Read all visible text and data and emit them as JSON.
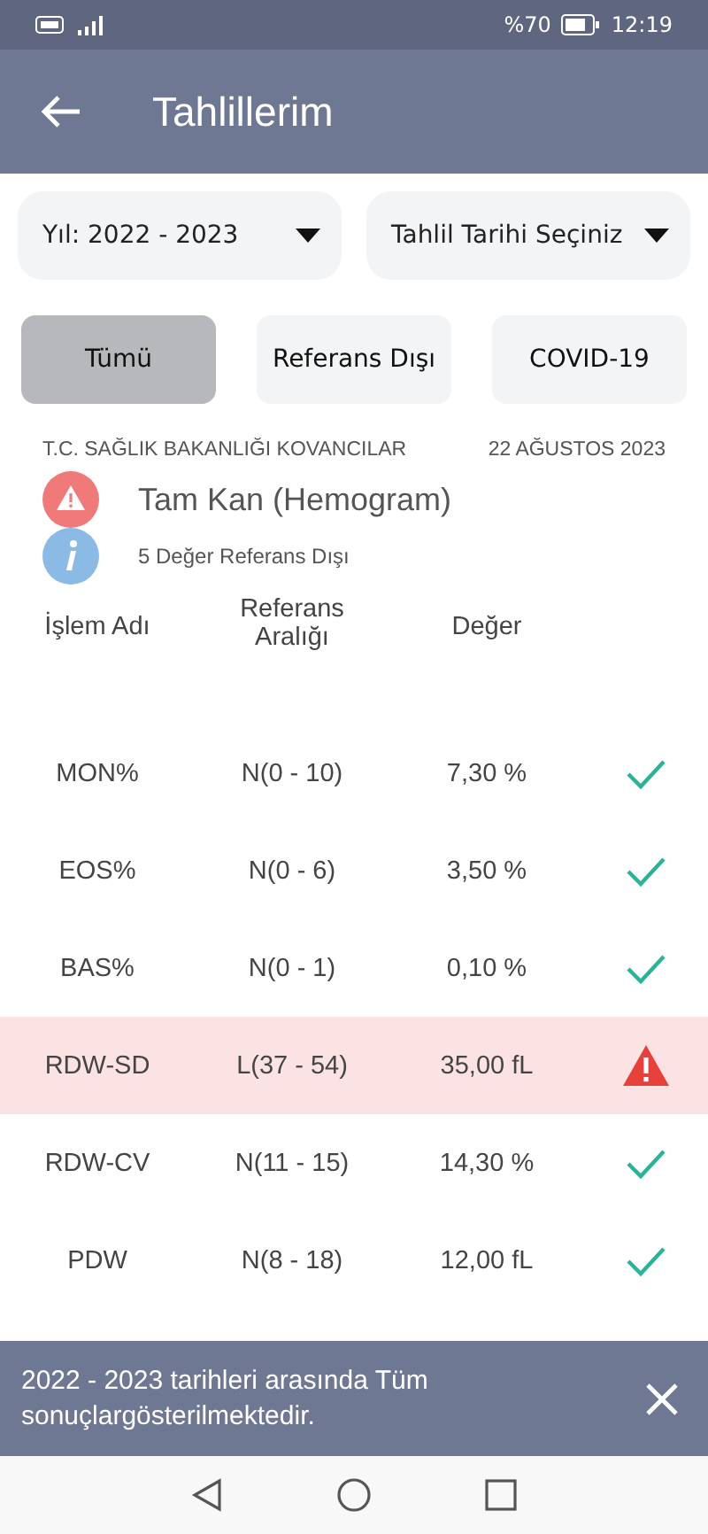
{
  "status_bar": {
    "battery": "%70",
    "time": "12:19"
  },
  "app_bar": {
    "title": "Tahlillerim"
  },
  "dropdowns": [
    {
      "label": "Yıl: 2022 - 2023"
    },
    {
      "label": "Tahlil Tarihi Seçiniz"
    }
  ],
  "filters": [
    {
      "label": "Tümü",
      "selected": true
    },
    {
      "label": "Referans Dışı",
      "selected": false
    },
    {
      "label": "COVID-19",
      "selected": false
    }
  ],
  "result": {
    "institution": "T.C. SAĞLIK BAKANLIĞI KOVANCILAR",
    "date": "22 AĞUSTOS 2023",
    "test_name": "Tam Kan (Hemogram)",
    "summary": "5 Değer Referans Dışı"
  },
  "table": {
    "columns": [
      "İşlem Adı",
      "Referans Aralığı",
      "Değer"
    ],
    "rows": [
      {
        "name": "MON%",
        "range": "N(0 - 10)",
        "value": "7,30 %",
        "out_of_range": false
      },
      {
        "name": "EOS%",
        "range": "N(0 - 6)",
        "value": "3,50 %",
        "out_of_range": false
      },
      {
        "name": "BAS%",
        "range": "N(0 - 1)",
        "value": "0,10 %",
        "out_of_range": false
      },
      {
        "name": "RDW-SD",
        "range": "L(37 - 54)",
        "value": "35,00 fL",
        "out_of_range": true
      },
      {
        "name": "RDW-CV",
        "range": "N(11 - 15)",
        "value": "14,30 %",
        "out_of_range": false
      },
      {
        "name": "PDW",
        "range": "N(8 - 18)",
        "value": "12,00 fL",
        "out_of_range": false
      }
    ]
  },
  "snackbar": {
    "message": "2022 - 2023 tarihleri arasında Tüm sonuçlargösterilmektedir."
  }
}
